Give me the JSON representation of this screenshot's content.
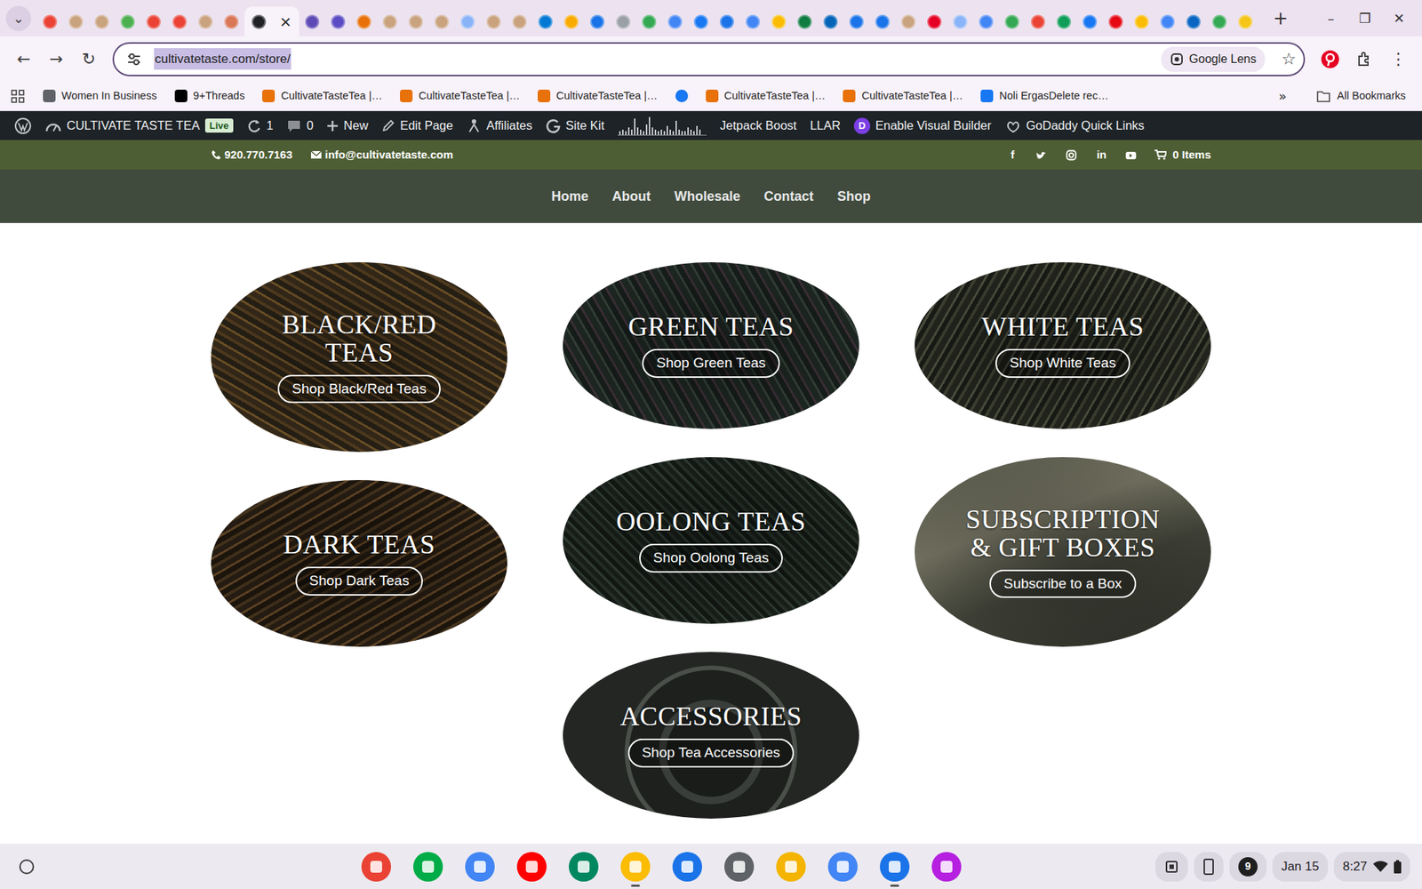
{
  "browser": {
    "tab_search": "⌄",
    "tabs": [
      {
        "selected": false,
        "color": "#ea4335"
      },
      {
        "selected": false,
        "color": "#c9a27e"
      },
      {
        "selected": false,
        "color": "#c9a27e"
      },
      {
        "selected": false,
        "color": "#4caf50"
      },
      {
        "selected": false,
        "color": "#ea4335"
      },
      {
        "selected": false,
        "color": "#ea4335"
      },
      {
        "selected": false,
        "color": "#c9a27e"
      },
      {
        "selected": false,
        "color": "#d97757"
      },
      {
        "selected": true,
        "color": "#202124"
      },
      {
        "selected": false,
        "color": "#5f4bb6"
      },
      {
        "selected": false,
        "color": "#5b4bc4"
      },
      {
        "selected": false,
        "color": "#e8710a"
      },
      {
        "selected": false,
        "color": "#c9a27e"
      },
      {
        "selected": false,
        "color": "#c9a27e"
      },
      {
        "selected": false,
        "color": "#c9a27e"
      },
      {
        "selected": false,
        "color": "#8ab4f8"
      },
      {
        "selected": false,
        "color": "#c9a27e"
      },
      {
        "selected": false,
        "color": "#c9a27e"
      },
      {
        "selected": false,
        "color": "#0078d4"
      },
      {
        "selected": false,
        "color": "#f9ab00"
      },
      {
        "selected": false,
        "color": "#1a73e8"
      },
      {
        "selected": false,
        "color": "#9aa0a6"
      },
      {
        "selected": false,
        "color": "#34a853"
      },
      {
        "selected": false,
        "color": "#4285f4"
      },
      {
        "selected": false,
        "color": "#1877f2"
      },
      {
        "selected": false,
        "color": "#1a73e8"
      },
      {
        "selected": false,
        "color": "#4285f4"
      },
      {
        "selected": false,
        "color": "#fbbc04"
      },
      {
        "selected": false,
        "color": "#107c41"
      },
      {
        "selected": false,
        "color": "#0364b8"
      },
      {
        "selected": false,
        "color": "#1a73e8"
      },
      {
        "selected": false,
        "color": "#1a73e8"
      },
      {
        "selected": false,
        "color": "#c9a27e"
      },
      {
        "selected": false,
        "color": "#e60023"
      },
      {
        "selected": false,
        "color": "#8ab4f8"
      },
      {
        "selected": false,
        "color": "#4285f4"
      },
      {
        "selected": false,
        "color": "#34a853"
      },
      {
        "selected": false,
        "color": "#ea4335"
      },
      {
        "selected": false,
        "color": "#0f9d58"
      },
      {
        "selected": false,
        "color": "#1877f2"
      },
      {
        "selected": false,
        "color": "#e50914"
      },
      {
        "selected": false,
        "color": "#fbbc04"
      },
      {
        "selected": false,
        "color": "#4285f4"
      },
      {
        "selected": false,
        "color": "#0a66c2"
      },
      {
        "selected": false,
        "color": "#34a853"
      },
      {
        "selected": false,
        "color": "#f5c518"
      }
    ],
    "active_close": "×",
    "new_tab": "+",
    "controls": [
      "–",
      "❐",
      "✕"
    ]
  },
  "toolbar": {
    "back": "←",
    "forward": "→",
    "reload": "↻",
    "url": "cultivatetaste.com/store/",
    "url_selected": true,
    "lens": "Google Lens",
    "star": "☆",
    "menu": "⋮"
  },
  "bookmarks": {
    "items": [
      {
        "kind": "link",
        "label": "Women In Business",
        "color": "#5f6368"
      },
      {
        "kind": "link",
        "label": "9+Threads",
        "color": "#000000"
      },
      {
        "kind": "link",
        "label": "CultivateTasteTea |…",
        "color": "#e8710a"
      },
      {
        "kind": "link",
        "label": "CultivateTasteTea |…",
        "color": "#e8710a"
      },
      {
        "kind": "link",
        "label": "CultivateTasteTea |…",
        "color": "#e8710a"
      },
      {
        "kind": "icon",
        "color": "#1877f2"
      },
      {
        "kind": "link",
        "label": "CultivateTasteTea |…",
        "color": "#e8710a"
      },
      {
        "kind": "link",
        "label": "CultivateTasteTea |…",
        "color": "#e8710a"
      },
      {
        "kind": "link",
        "label": "Noli ErgasDelete rec…",
        "color": "#1877f2"
      }
    ],
    "overflow": "»",
    "all": "All Bookmarks"
  },
  "admin_bar": {
    "site": "CULTIVATE TASTE TEA",
    "badge": "Live",
    "updates": "1",
    "comments": "0",
    "new": "New",
    "edit": "Edit Page",
    "affiliates": "Affiliates",
    "site_kit": "Site Kit",
    "stats": [
      2,
      3,
      2,
      4,
      3,
      9,
      4,
      3,
      2,
      6,
      10,
      4,
      3,
      2,
      3,
      2,
      5,
      3,
      2,
      8,
      3,
      2,
      2,
      4,
      3,
      2,
      5,
      3
    ],
    "jetpack": "Jetpack Boost",
    "llar": "LLAR",
    "divi_letter": "D",
    "divi": "Enable Visual Builder",
    "godaddy": "GoDaddy Quick Links"
  },
  "top_bar": {
    "phone": "920.770.7163",
    "email": "info@cultivatetaste.com",
    "socials": [
      {
        "kind": "facebook",
        "glyph": "f"
      },
      {
        "kind": "twitter"
      },
      {
        "kind": "instagram"
      },
      {
        "kind": "linkedin",
        "glyph": "in"
      },
      {
        "kind": "youtube"
      }
    ],
    "cart": "0 Items"
  },
  "nav": [
    "Home",
    "About",
    "Wholesale",
    "Contact",
    "Shop"
  ],
  "categories": [
    {
      "title": "BLACK/RED TEAS",
      "button": "Shop Black/Red Teas"
    },
    {
      "title": "GREEN TEAS",
      "button": "Shop Green Teas"
    },
    {
      "title": "WHITE TEAS",
      "button": "Shop White Teas"
    },
    {
      "title": "DARK TEAS",
      "button": "Shop Dark Teas"
    },
    {
      "title": "OOLONG TEAS",
      "button": "Shop Oolong Teas"
    },
    {
      "title": "SUBSCRIPTION & GIFT BOXES",
      "button": "Subscribe to a Box"
    },
    {
      "title": "ACCESSORIES",
      "button": "Shop Tea Accessories"
    }
  ],
  "shelf": {
    "apps": [
      {
        "color": "#ea4335",
        "active": false
      },
      {
        "color": "#00ac47",
        "active": false
      },
      {
        "color": "#4285f4",
        "active": false
      },
      {
        "color": "#ff0000",
        "active": false
      },
      {
        "color": "#01875f",
        "active": false
      },
      {
        "color": "#fbbc04",
        "active": true
      },
      {
        "color": "#1a73e8",
        "active": false
      },
      {
        "color": "#5f6368",
        "active": false
      },
      {
        "color": "#f4b400",
        "active": false
      },
      {
        "color": "#4285f4",
        "active": false
      },
      {
        "color": "#1a73e8",
        "active": true
      },
      {
        "color": "#b620e0",
        "active": false
      }
    ],
    "notifications": "9",
    "date": "Jan 15",
    "time": "8:27"
  }
}
